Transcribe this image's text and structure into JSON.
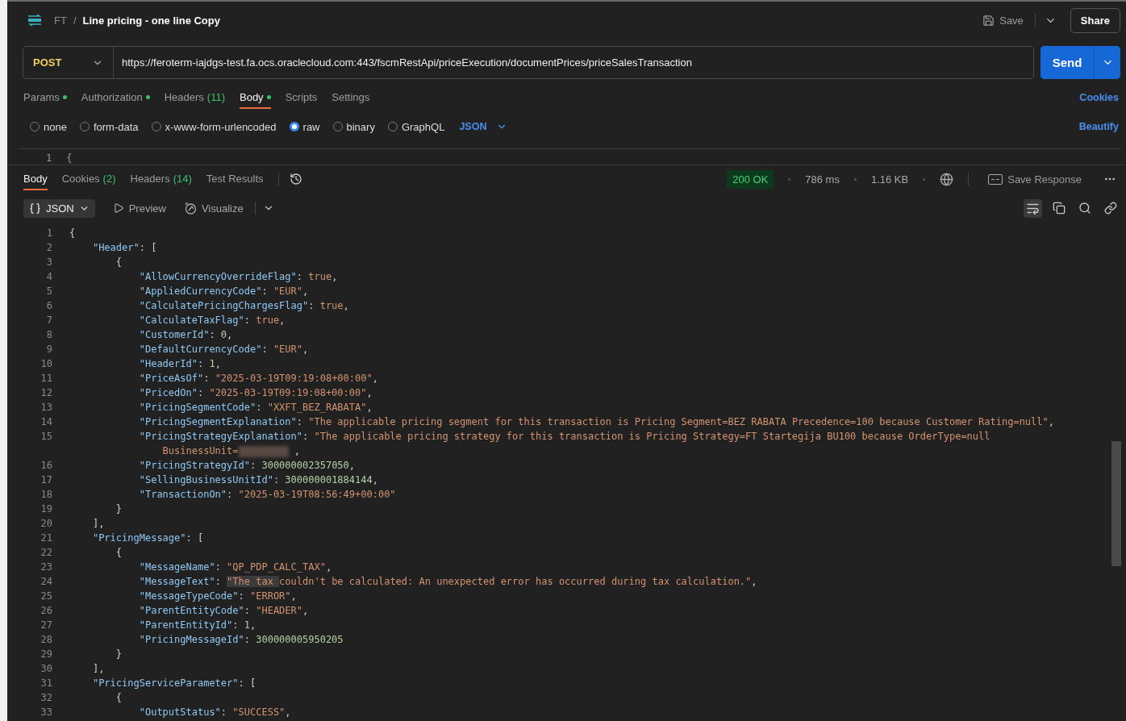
{
  "breadcrumb": {
    "workspace": "FT",
    "separator": "/",
    "title": "Line pricing - one line Copy"
  },
  "header_actions": {
    "save": "Save",
    "share": "Share"
  },
  "request": {
    "method": "POST",
    "url": "https://feroterm-iajdgs-test.fa.ocs.oraclecloud.com:443/fscmRestApi/priceExecution/documentPrices/priceSalesTransaction",
    "send": "Send"
  },
  "request_tabs": [
    {
      "label": "Params",
      "dot": true,
      "selected": false
    },
    {
      "label": "Authorization",
      "dot": true,
      "selected": false
    },
    {
      "label": "Headers",
      "count": "(11)",
      "dot": false,
      "selected": false
    },
    {
      "label": "Body",
      "dot": true,
      "selected": true
    },
    {
      "label": "Scripts",
      "dot": false,
      "selected": false
    },
    {
      "label": "Settings",
      "dot": false,
      "selected": false
    }
  ],
  "cookies_link": "Cookies",
  "body_types": [
    {
      "label": "none",
      "selected": false
    },
    {
      "label": "form-data",
      "selected": false
    },
    {
      "label": "x-www-form-urlencoded",
      "selected": false
    },
    {
      "label": "raw",
      "selected": true
    },
    {
      "label": "binary",
      "selected": false
    },
    {
      "label": "GraphQL",
      "selected": false
    }
  ],
  "body_format": "JSON",
  "beautify": "Beautify",
  "request_editor": {
    "line": "1",
    "text": "{"
  },
  "response_tabs": [
    {
      "label": "Body",
      "selected": true
    },
    {
      "label": "Cookies",
      "count": "(2)",
      "selected": false
    },
    {
      "label": "Headers",
      "count": "(14)",
      "selected": false
    },
    {
      "label": "Test Results",
      "selected": false
    }
  ],
  "status": {
    "code": "200 OK",
    "time": "786 ms",
    "size": "1.16 KB",
    "save_response": "Save Response"
  },
  "view_modes": {
    "format": "JSON",
    "preview": "Preview",
    "visualize": "Visualize"
  },
  "code_lines": [
    {
      "number": "1",
      "tokens": [
        {
          "kind": "punct",
          "text": "{"
        }
      ]
    },
    {
      "number": "2",
      "tokens": [
        {
          "kind": "key",
          "text": "\"Header\""
        },
        {
          "kind": "punct",
          "text": ": ["
        }
      ]
    },
    {
      "number": "3",
      "tokens": [
        {
          "kind": "punct",
          "text": "{"
        }
      ]
    },
    {
      "number": "4",
      "tokens": [
        {
          "kind": "key",
          "text": "\"AllowCurrencyOverrideFlag\""
        },
        {
          "kind": "punct",
          "text": ": "
        },
        {
          "kind": "bool",
          "text": "true"
        },
        {
          "kind": "punct",
          "text": ","
        }
      ]
    },
    {
      "number": "5",
      "tokens": [
        {
          "kind": "key",
          "text": "\"AppliedCurrencyCode\""
        },
        {
          "kind": "punct",
          "text": ": "
        },
        {
          "kind": "string",
          "text": "\"EUR\""
        },
        {
          "kind": "punct",
          "text": ","
        }
      ]
    },
    {
      "number": "6",
      "tokens": [
        {
          "kind": "key",
          "text": "\"CalculatePricingChargesFlag\""
        },
        {
          "kind": "punct",
          "text": ": "
        },
        {
          "kind": "bool",
          "text": "true"
        },
        {
          "kind": "punct",
          "text": ","
        }
      ]
    },
    {
      "number": "7",
      "tokens": [
        {
          "kind": "key",
          "text": "\"CalculateTaxFlag\""
        },
        {
          "kind": "punct",
          "text": ": "
        },
        {
          "kind": "bool",
          "text": "true"
        },
        {
          "kind": "punct",
          "text": ","
        }
      ]
    },
    {
      "number": "8",
      "tokens": [
        {
          "kind": "key",
          "text": "\"CustomerId\""
        },
        {
          "kind": "punct",
          "text": ": "
        },
        {
          "kind": "number",
          "text": "0"
        },
        {
          "kind": "punct",
          "text": ","
        }
      ]
    },
    {
      "number": "9",
      "tokens": [
        {
          "kind": "key",
          "text": "\"DefaultCurrencyCode\""
        },
        {
          "kind": "punct",
          "text": ": "
        },
        {
          "kind": "string",
          "text": "\"EUR\""
        },
        {
          "kind": "punct",
          "text": ","
        }
      ]
    },
    {
      "number": "10",
      "tokens": [
        {
          "kind": "key",
          "text": "\"HeaderId\""
        },
        {
          "kind": "punct",
          "text": ": "
        },
        {
          "kind": "number",
          "text": "1"
        },
        {
          "kind": "punct",
          "text": ","
        }
      ]
    },
    {
      "number": "11",
      "tokens": [
        {
          "kind": "key",
          "text": "\"PriceAsOf\""
        },
        {
          "kind": "punct",
          "text": ": "
        },
        {
          "kind": "string",
          "text": "\"2025-03-19T09:19:08+00:00\""
        },
        {
          "kind": "punct",
          "text": ","
        }
      ]
    },
    {
      "number": "12",
      "tokens": [
        {
          "kind": "key",
          "text": "\"PricedOn\""
        },
        {
          "kind": "punct",
          "text": ": "
        },
        {
          "kind": "string",
          "text": "\"2025-03-19T09:19:08+00:00\""
        },
        {
          "kind": "punct",
          "text": ","
        }
      ]
    },
    {
      "number": "13",
      "tokens": [
        {
          "kind": "key",
          "text": "\"PricingSegmentCode\""
        },
        {
          "kind": "punct",
          "text": ": "
        },
        {
          "kind": "string",
          "text": "\"XXFT_BEZ_RABATA\""
        },
        {
          "kind": "punct",
          "text": ","
        }
      ]
    },
    {
      "number": "14",
      "tokens": [
        {
          "kind": "key",
          "text": "\"PricingSegmentExplanation\""
        },
        {
          "kind": "punct",
          "text": ": "
        },
        {
          "kind": "string",
          "text": "\"The applicable pricing segment for this transaction is Pricing Segment=BEZ RABATA Precedence=100 because Customer Rating=null\""
        },
        {
          "kind": "punct",
          "text": ","
        }
      ]
    },
    {
      "number": "15",
      "tokens": [
        {
          "kind": "key",
          "text": "\"PricingStrategyExplanation\""
        },
        {
          "kind": "punct",
          "text": ": "
        },
        {
          "kind": "string",
          "text": "\"The applicable pricing strategy for this transaction is Pricing Strategy=FT Startegija BU100 because OrderType=null"
        }
      ],
      "wrapped": [
        {
          "kind": "string",
          "text": "BusinessUnit="
        },
        {
          "kind": "redacted"
        },
        {
          "kind": "punct",
          "text": " ,"
        }
      ]
    },
    {
      "number": "16",
      "tokens": [
        {
          "kind": "key",
          "text": "\"PricingStrategyId\""
        },
        {
          "kind": "punct",
          "text": ": "
        },
        {
          "kind": "number",
          "text": "300000002357050"
        },
        {
          "kind": "punct",
          "text": ","
        }
      ]
    },
    {
      "number": "17",
      "tokens": [
        {
          "kind": "key",
          "text": "\"SellingBusinessUnitId\""
        },
        {
          "kind": "punct",
          "text": ": "
        },
        {
          "kind": "number",
          "text": "300000001884144"
        },
        {
          "kind": "punct",
          "text": ","
        }
      ]
    },
    {
      "number": "18",
      "tokens": [
        {
          "kind": "key",
          "text": "\"TransactionOn\""
        },
        {
          "kind": "punct",
          "text": ": "
        },
        {
          "kind": "string",
          "text": "\"2025-03-19T08:56:49+00:00\""
        }
      ]
    },
    {
      "number": "19",
      "tokens": [
        {
          "kind": "punct",
          "text": "}"
        }
      ]
    },
    {
      "number": "20",
      "tokens": [
        {
          "kind": "punct",
          "text": "],"
        }
      ]
    },
    {
      "number": "21",
      "tokens": [
        {
          "kind": "key",
          "text": "\"PricingMessage\""
        },
        {
          "kind": "punct",
          "text": ": ["
        }
      ]
    },
    {
      "number": "22",
      "tokens": [
        {
          "kind": "punct",
          "text": "{"
        }
      ]
    },
    {
      "number": "23",
      "tokens": [
        {
          "kind": "key",
          "text": "\"MessageName\""
        },
        {
          "kind": "punct",
          "text": ": "
        },
        {
          "kind": "string",
          "text": "\"QP_PDP_CALC_TAX\""
        },
        {
          "kind": "punct",
          "text": ","
        }
      ]
    },
    {
      "number": "24",
      "tokens": [
        {
          "kind": "key",
          "text": "\"MessageText\""
        },
        {
          "kind": "punct",
          "text": ": "
        },
        {
          "kind": "string",
          "text": "\"The tax ",
          "selected": true
        },
        {
          "kind": "string",
          "text": "couldn't be calculated: An unexpected error has occurred during tax calculation.\""
        },
        {
          "kind": "punct",
          "text": ","
        }
      ]
    },
    {
      "number": "25",
      "tokens": [
        {
          "kind": "key",
          "text": "\"MessageTypeCode\""
        },
        {
          "kind": "punct",
          "text": ": "
        },
        {
          "kind": "string",
          "text": "\"ERROR\""
        },
        {
          "kind": "punct",
          "text": ","
        }
      ]
    },
    {
      "number": "26",
      "tokens": [
        {
          "kind": "key",
          "text": "\"ParentEntityCode\""
        },
        {
          "kind": "punct",
          "text": ": "
        },
        {
          "kind": "string",
          "text": "\"HEADER\""
        },
        {
          "kind": "punct",
          "text": ","
        }
      ]
    },
    {
      "number": "27",
      "tokens": [
        {
          "kind": "key",
          "text": "\"ParentEntityId\""
        },
        {
          "kind": "punct",
          "text": ": "
        },
        {
          "kind": "number",
          "text": "1"
        },
        {
          "kind": "punct",
          "text": ","
        }
      ]
    },
    {
      "number": "28",
      "tokens": [
        {
          "kind": "key",
          "text": "\"PricingMessageId\""
        },
        {
          "kind": "punct",
          "text": ": "
        },
        {
          "kind": "number",
          "text": "300000005950205"
        }
      ]
    },
    {
      "number": "29",
      "tokens": [
        {
          "kind": "punct",
          "text": "}"
        }
      ]
    },
    {
      "number": "30",
      "tokens": [
        {
          "kind": "punct",
          "text": "],"
        }
      ]
    },
    {
      "number": "31",
      "tokens": [
        {
          "kind": "key",
          "text": "\"PricingServiceParameter\""
        },
        {
          "kind": "punct",
          "text": ": ["
        }
      ]
    },
    {
      "number": "32",
      "tokens": [
        {
          "kind": "punct",
          "text": "{"
        }
      ]
    },
    {
      "number": "33",
      "tokens": [
        {
          "kind": "key",
          "text": "\"OutputStatus\""
        },
        {
          "kind": "punct",
          "text": ": "
        },
        {
          "kind": "string",
          "text": "\"SUCCESS\""
        },
        {
          "kind": "punct",
          "text": ","
        }
      ]
    }
  ]
}
